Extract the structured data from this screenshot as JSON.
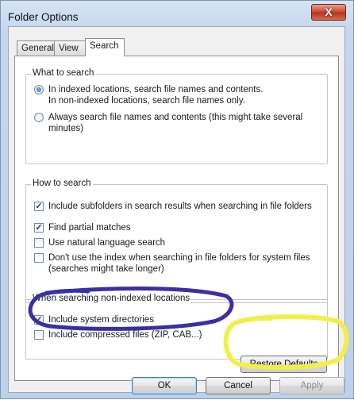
{
  "window": {
    "title": "Folder Options",
    "close_symbol": "X"
  },
  "tabs": [
    "General",
    "View",
    "Search"
  ],
  "what_to_search": {
    "legend": "What to search",
    "option1_line1": "In indexed locations, search file names and contents.",
    "option1_line2": "In non-indexed locations, search file names only.",
    "option1_selected": true,
    "option2_line1": "Always search file names and contents (this might take several",
    "option2_line2": "minutes)",
    "option2_selected": false
  },
  "how_to_search": {
    "legend": "How to search",
    "items": [
      {
        "label": "Include subfolders in search results when searching in file folders",
        "checked": true
      },
      {
        "label": "Find partial matches",
        "checked": true
      },
      {
        "label": "Use natural language search",
        "checked": false
      },
      {
        "label_line1": "Don't use the index when searching in file folders for system files",
        "label_line2": "(searches might take longer)",
        "checked": false
      }
    ]
  },
  "non_indexed": {
    "legend": "When searching non-indexed locations",
    "items": [
      {
        "label": "Include system directories",
        "checked": true
      },
      {
        "label": "Include compressed files (ZIP, CAB...)",
        "checked": false
      }
    ]
  },
  "buttons": {
    "restore_defaults": "Restore Defaults",
    "ok": "OK",
    "cancel": "Cancel",
    "apply": "Apply"
  },
  "colors": {
    "annotation_purple": "#3b2fa3",
    "annotation_yellow": "#f2ef4a"
  }
}
